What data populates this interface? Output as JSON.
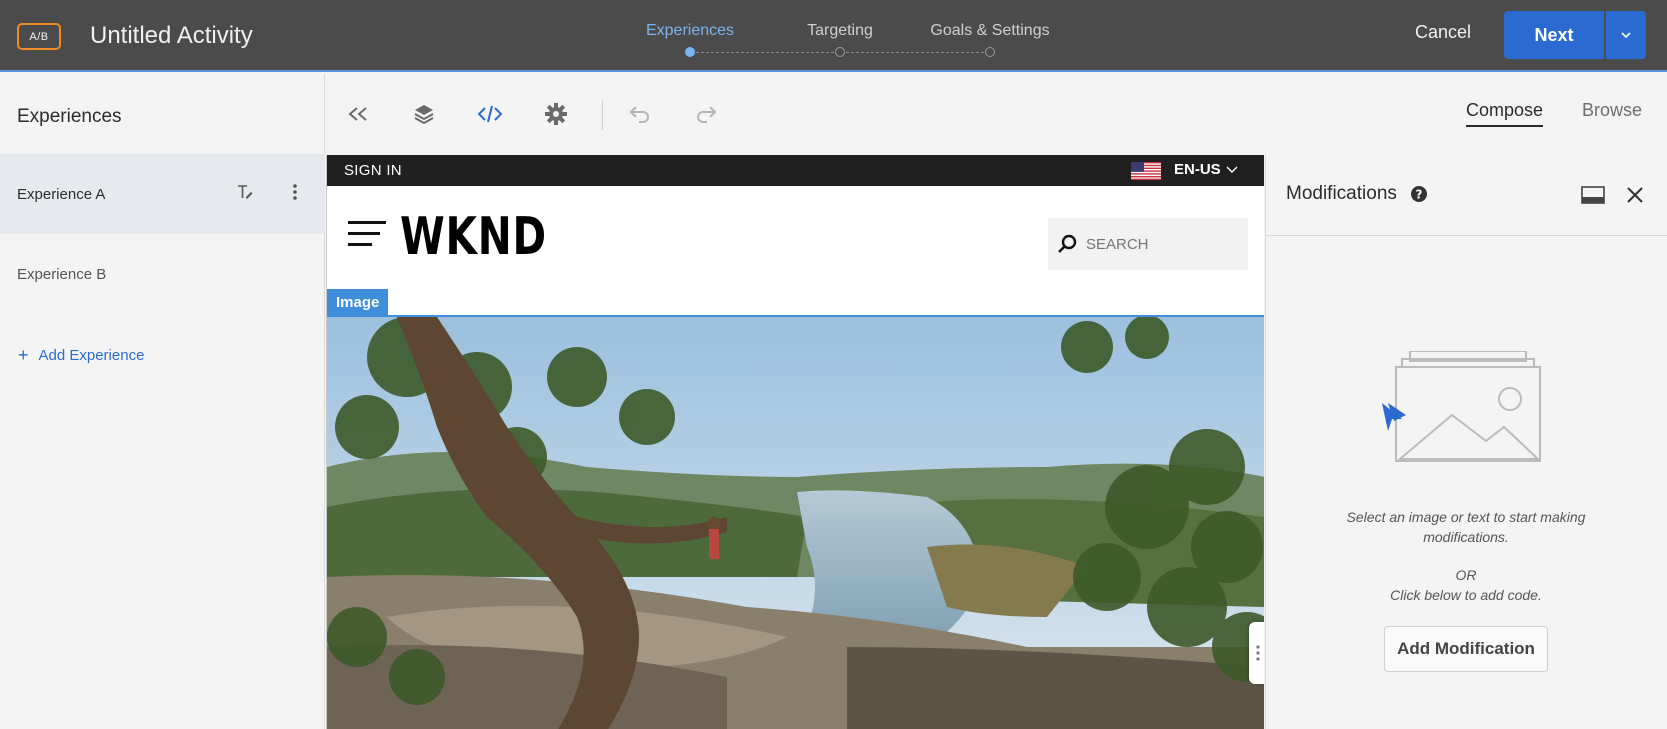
{
  "topbar": {
    "badge": "A/B",
    "activity_title": "Untitled Activity",
    "steps": [
      {
        "label": "Experiences",
        "state": "active"
      },
      {
        "label": "Targeting",
        "state": "pending"
      },
      {
        "label": "Goals & Settings",
        "state": "pending"
      }
    ],
    "cancel_label": "Cancel",
    "next_label": "Next",
    "accent_color": "#2b6bd1",
    "badge_color": "#f08a24"
  },
  "sidebar": {
    "title": "Experiences",
    "items": [
      {
        "label": "Experience A",
        "selected": true
      },
      {
        "label": "Experience B",
        "selected": false
      }
    ],
    "add_label": "Add Experience"
  },
  "toolbar": {
    "icons": [
      "collapse-icon",
      "layers-icon",
      "code-icon",
      "gear-icon",
      "undo-icon",
      "redo-icon"
    ],
    "modes": [
      {
        "label": "Compose",
        "active": true
      },
      {
        "label": "Browse",
        "active": false
      }
    ]
  },
  "preview": {
    "sign_in": "SIGN IN",
    "language": "EN-US",
    "logo": "WKND",
    "search_placeholder": "SEARCH",
    "selected_element_label": "Image"
  },
  "modifications": {
    "title": "Modifications",
    "empty_text": "Select an image or text to start making modifications.",
    "or_text": "OR",
    "code_text": "Click below to add code.",
    "add_button": "Add Modification"
  }
}
